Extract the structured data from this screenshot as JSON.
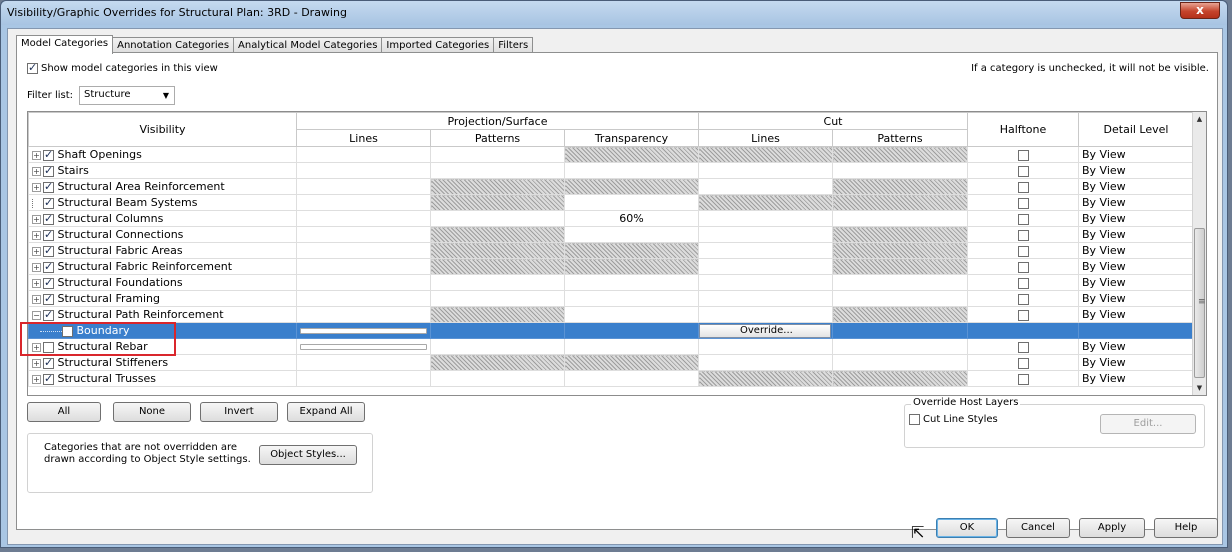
{
  "window": {
    "title": "Visibility/Graphic Overrides for Structural Plan: 3RD - Drawing",
    "close_label": "x"
  },
  "tabs": [
    {
      "label": "Model Categories"
    },
    {
      "label": "Annotation Categories"
    },
    {
      "label": "Analytical Model Categories"
    },
    {
      "label": "Imported Categories"
    },
    {
      "label": "Filters"
    }
  ],
  "show_categories": {
    "label": "Show model categories in this view",
    "checked": true
  },
  "hint": "If a category is unchecked, it will not be visible.",
  "filter": {
    "label": "Filter list:",
    "value": "Structure"
  },
  "grid": {
    "header": {
      "visibility": "Visibility",
      "projection": "Projection/Surface",
      "cut": "Cut",
      "halftone": "Halftone",
      "detail_level": "Detail Level",
      "lines": "Lines",
      "patterns": "Patterns",
      "transparency": "Transparency",
      "cut_lines": "Lines",
      "cut_patterns": "Patterns"
    },
    "rows": [
      {
        "name": "Shaft Openings",
        "detail": "By View",
        "transparency": ""
      },
      {
        "name": "Stairs",
        "detail": "By View",
        "transparency": ""
      },
      {
        "name": "Structural Area Reinforcement",
        "detail": "By View",
        "transparency": ""
      },
      {
        "name": "Structural Beam Systems",
        "detail": "By View",
        "transparency": ""
      },
      {
        "name": "Structural Columns",
        "detail": "By View",
        "transparency": "60%"
      },
      {
        "name": "Structural Connections",
        "detail": "By View",
        "transparency": ""
      },
      {
        "name": "Structural Fabric Areas",
        "detail": "By View",
        "transparency": ""
      },
      {
        "name": "Structural Fabric Reinforcement",
        "detail": "By View",
        "transparency": ""
      },
      {
        "name": "Structural Foundations",
        "detail": "By View",
        "transparency": ""
      },
      {
        "name": "Structural Framing",
        "detail": "By View",
        "transparency": ""
      },
      {
        "name": "Structural Path Reinforcement",
        "detail": "By View",
        "transparency": ""
      },
      {
        "name": "Boundary",
        "override": "Override..."
      },
      {
        "name": "Structural Rebar",
        "detail": "By View"
      },
      {
        "name": "Structural Stiffeners",
        "detail": "By View"
      },
      {
        "name": "Structural Trusses",
        "detail": "By View"
      }
    ]
  },
  "buttons": {
    "all": "All",
    "none": "None",
    "invert": "Invert",
    "expand_all": "Expand All",
    "object_styles": "Object Styles...",
    "edit": "Edit...",
    "ok": "OK",
    "cancel": "Cancel",
    "apply": "Apply",
    "help": "Help"
  },
  "note": "Categories that are not overridden are drawn according to Object Style settings.",
  "override_host": {
    "title": "Override Host Layers",
    "cut_line_styles": "Cut Line Styles"
  }
}
